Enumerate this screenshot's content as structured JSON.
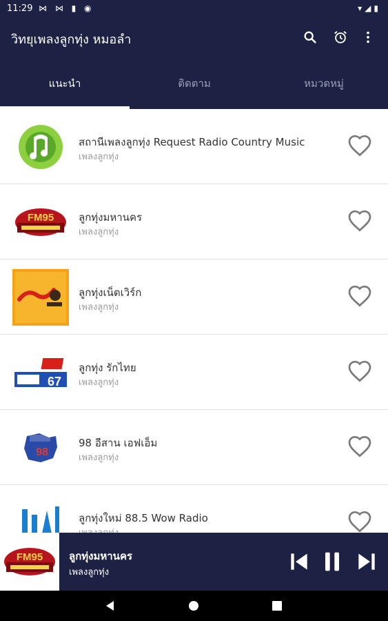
{
  "status_bar": {
    "time": "11:29",
    "left_icons": "⋈ ⋈ ▮ ◉",
    "right_icons": "▾◢▮"
  },
  "app_bar": {
    "title": "วิทยุเพลงลูกทุ่ง หมอลำ",
    "actions": [
      "search-icon",
      "alarm-icon",
      "more-vert-icon"
    ]
  },
  "tabs": [
    {
      "label": "แนะนำ",
      "active": true
    },
    {
      "label": "ติดตาม",
      "active": false
    },
    {
      "label": "หมวดหมู่",
      "active": false
    }
  ],
  "stations": [
    {
      "name": "สถานีเพลงลูกทุ่ง Request Radio Country Music",
      "category": "เพลงลูกทุ่ง",
      "logo": "green-music-logo"
    },
    {
      "name": "ลูกทุ่งมหานคร",
      "category": "เพลงลูกทุ่ง",
      "logo": "fm95-logo",
      "logo_text": "FM95"
    },
    {
      "name": "ลูกทุ่งเน็ตเวิร์ก",
      "category": "เพลงลูกทุ่ง",
      "logo": "orange-network-logo"
    },
    {
      "name": "ลูกทุ่ง รักไทย",
      "category": "เพลงลูกทุ่ง",
      "logo": "rakthai-logo",
      "logo_text": "67"
    },
    {
      "name": "98 อีสาน เอฟเอ็ม",
      "category": "เพลงลูกทุ่ง",
      "logo": "isan98-logo",
      "logo_text": "98"
    },
    {
      "name": "ลูกทุ่งใหม่ 88.5 Wow Radio",
      "category": "เพลงลูกทุ่ง",
      "logo": "wow-radio-logo"
    }
  ],
  "player": {
    "title": "ลูกทุ่งมหานคร",
    "category": "เพลงลูกทุ่ง",
    "logo_text": "FM95",
    "controls": [
      "skip-previous-icon",
      "pause-icon",
      "skip-next-icon"
    ]
  },
  "nav_bar": [
    "back-icon",
    "home-icon",
    "recents-icon"
  ],
  "colors": {
    "primary": "#1d2244",
    "white": "#ffffff",
    "heart": "#7a7a7a"
  }
}
